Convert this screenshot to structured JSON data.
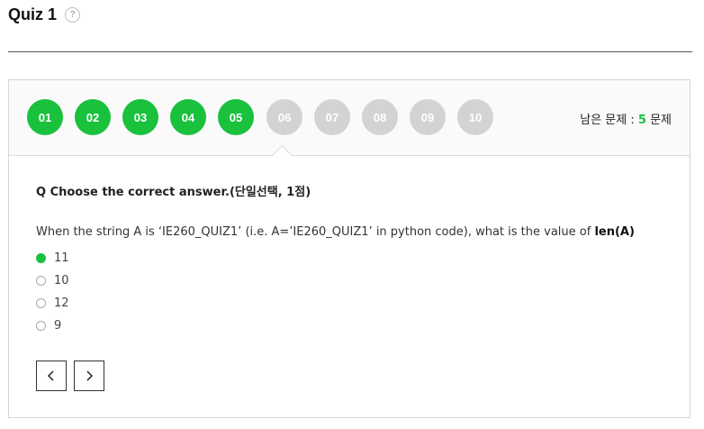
{
  "page": {
    "title": "Quiz 1",
    "help_symbol": "?"
  },
  "question_nav": {
    "items": [
      {
        "label": "01",
        "state": "answered"
      },
      {
        "label": "02",
        "state": "answered"
      },
      {
        "label": "03",
        "state": "answered"
      },
      {
        "label": "04",
        "state": "answered"
      },
      {
        "label": "05",
        "state": "answered"
      },
      {
        "label": "06",
        "state": "unanswered"
      },
      {
        "label": "07",
        "state": "unanswered"
      },
      {
        "label": "08",
        "state": "unanswered"
      },
      {
        "label": "09",
        "state": "unanswered"
      },
      {
        "label": "10",
        "state": "unanswered"
      }
    ],
    "current_index": 6,
    "remaining_label": "남은 문제 :",
    "remaining_count": "5",
    "remaining_unit": "문제"
  },
  "question": {
    "title": "Q  Choose the correct answer.(단일선택, 1점)",
    "text_prefix": "When the string A is ‘IE260_QUIZ1’ (i.e. A=’IE260_QUIZ1’ in python code), what is the value of ",
    "text_bold": "len(A)",
    "options": [
      {
        "label": "11",
        "selected": true
      },
      {
        "label": "10",
        "selected": false
      },
      {
        "label": "12",
        "selected": false
      },
      {
        "label": "9",
        "selected": false
      }
    ]
  },
  "navigation": {
    "prev_icon": "chevron-left-icon",
    "next_icon": "chevron-right-icon"
  },
  "colors": {
    "accent_green": "#19c13d",
    "unanswered_gray": "#d3d3d3"
  }
}
